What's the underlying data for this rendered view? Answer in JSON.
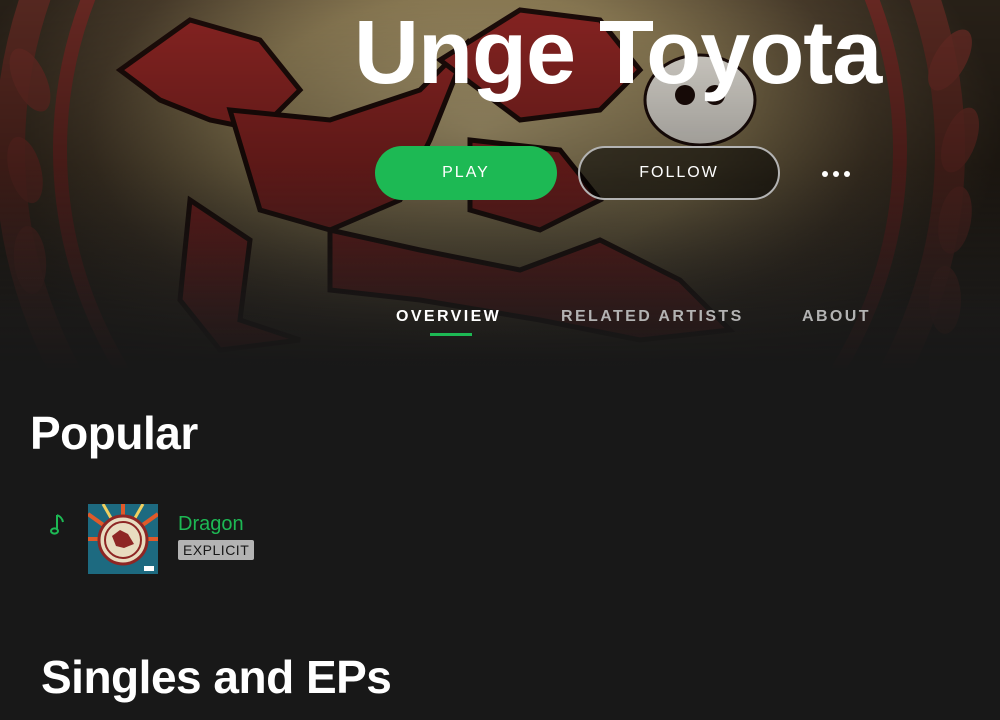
{
  "artist": {
    "name": "Unge Toyota"
  },
  "actions": {
    "play_label": "PLAY",
    "follow_label": "FOLLOW"
  },
  "tabs": [
    {
      "label": "OVERVIEW",
      "active": true
    },
    {
      "label": "RELATED ARTISTS",
      "active": false
    },
    {
      "label": "ABOUT",
      "active": false
    }
  ],
  "popular": {
    "title": "Popular",
    "tracks": [
      {
        "title": "Dragon",
        "badge": "EXPLICIT",
        "playing": true,
        "icon": "music-note-icon"
      }
    ]
  },
  "singles": {
    "title": "Singles and EPs"
  },
  "colors": {
    "accent": "#1db954",
    "background": "#181818",
    "muted": "#b3b3b3"
  }
}
